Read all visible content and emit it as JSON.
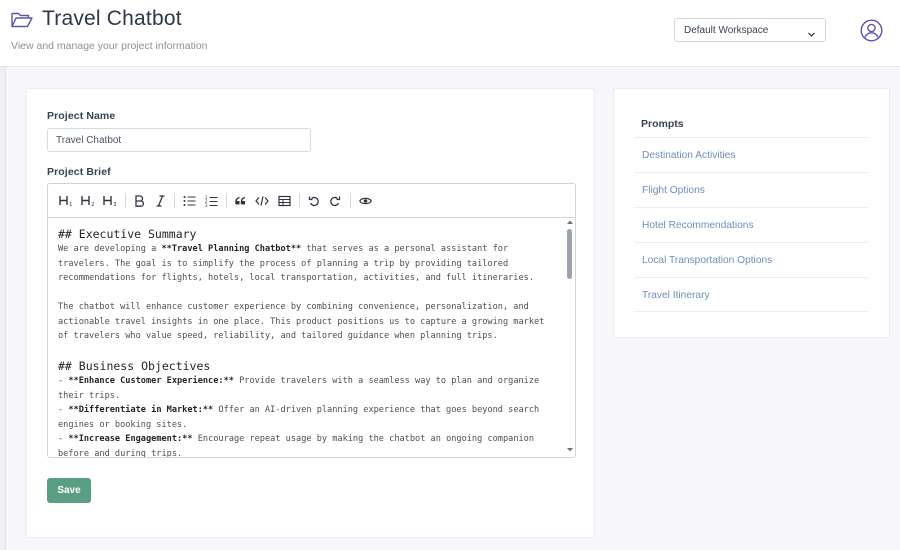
{
  "header": {
    "title": "Travel Chatbot",
    "subtitle": "View and manage your project information",
    "workspace_selected": "Default Workspace"
  },
  "form": {
    "project_name_label": "Project Name",
    "project_name_value": "Travel Chatbot",
    "project_brief_label": "Project Brief",
    "save_label": "Save"
  },
  "toolbar": {
    "buttons": [
      "heading-1",
      "heading-2",
      "heading-3",
      "bold",
      "italic",
      "bullet-list",
      "numbered-list",
      "quote",
      "code",
      "table",
      "undo",
      "redo",
      "preview"
    ]
  },
  "brief": {
    "h1": "## Executive Summary",
    "p1_pre": "We are developing a ",
    "p1_bold": "**Travel Planning Chatbot**",
    "p1_l1_post": " that serves as a personal assistant for",
    "p1_l2": "travelers. The goal is to simplify the process of planning a trip by providing tailored",
    "p1_l3": "recommendations for flights, hotels, local transportation, activities, and full itineraries.",
    "p2_l1": "The chatbot will enhance customer experience by combining convenience, personalization, and",
    "p2_l2": "actionable travel insights in one place. This product positions us to capture a growing market",
    "p2_l3": "of travelers who value speed, reliability, and tailored guidance when planning trips.",
    "h2": "## Business Objectives",
    "o1_bold": "**Enhance Customer Experience:**",
    "o1_l1_post": " Provide travelers with a seamless way to plan and organize",
    "o1_l2": "their trips.",
    "o2_bold": "**Differentiate in Market:**",
    "o2_l1_post": " Offer an AI-driven planning experience that goes beyond search",
    "o2_l2": "engines or booking sites.",
    "o3_bold": "**Increase Engagement:**",
    "o3_l1_post": " Encourage repeat usage by making the chatbot an ongoing companion",
    "o3_l2": "before and during trips.",
    "bullet": "- "
  },
  "prompts": {
    "title": "Prompts",
    "items": [
      "Destination Activities",
      "Flight Options",
      "Hotel Recommendations",
      "Local Transportation Options",
      "Travel Itinerary"
    ]
  },
  "colors": {
    "accent": "#5a9e84",
    "link": "#6b8fb5",
    "icon": "#5b55a8"
  }
}
